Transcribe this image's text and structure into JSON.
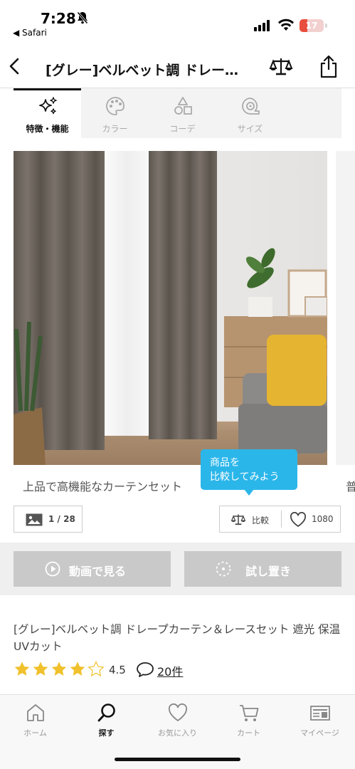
{
  "status_bar": {
    "time": "7:28",
    "back_app": "◀ Safari",
    "battery": "17",
    "battery_color": "#e84d3d"
  },
  "navbar": {
    "title": "[グレー]ベルベット調 ドレー…",
    "back_icon": "chevron-left-icon",
    "compare_icon": "scale-icon",
    "share_icon": "share-icon"
  },
  "tabs": [
    {
      "label": "特徴・機能",
      "icon": "sparkle-icon",
      "active": true
    },
    {
      "label": "カラー",
      "icon": "palette-icon",
      "active": false
    },
    {
      "label": "コーデ",
      "icon": "shapes-icon",
      "active": false
    },
    {
      "label": "サイズ",
      "icon": "tape-measure-icon",
      "active": false
    }
  ],
  "gallery": {
    "caption": "上品で高機能なカーテンセット",
    "next_caption_peek": "普",
    "counter": "1 / 28"
  },
  "tooltip": {
    "text": "商品を\n比較してみよう",
    "color": "#2bb6ea"
  },
  "actions": {
    "compare_label": "比較",
    "favorite_count": "1080",
    "video_label": "動画で見る",
    "try_label": "試し置き"
  },
  "product": {
    "title": "[グレー]ベルベット調 ドレープカーテン＆レースセット 遮光 保温 UVカット",
    "rating": "4.5",
    "review_count": "20件",
    "star_color": "#f0c12c"
  },
  "bottom_nav": [
    {
      "label": "ホーム",
      "icon": "home-icon",
      "active": false
    },
    {
      "label": "探す",
      "icon": "search-icon",
      "active": true
    },
    {
      "label": "お気に入り",
      "icon": "heart-icon",
      "active": false
    },
    {
      "label": "カート",
      "icon": "cart-icon",
      "active": false
    },
    {
      "label": "マイページ",
      "icon": "id-card-icon",
      "active": false
    }
  ]
}
